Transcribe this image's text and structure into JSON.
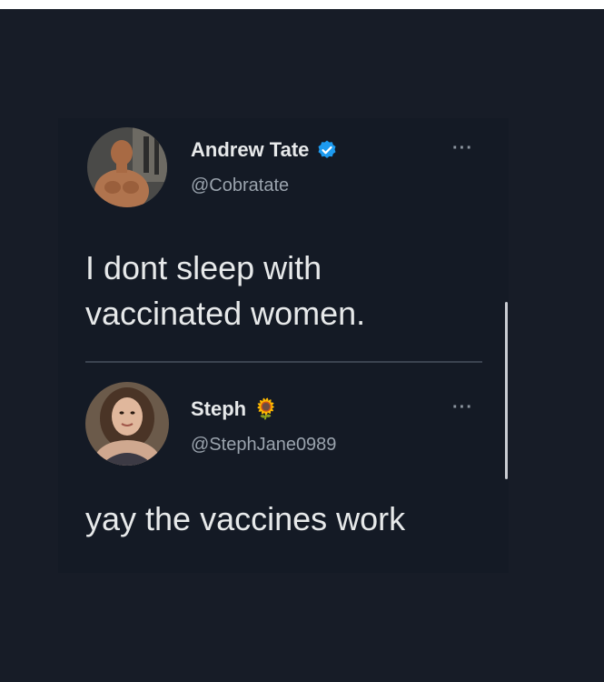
{
  "tweet": {
    "author_name": "Andrew Tate",
    "author_handle": "@Cobratate",
    "verified_icon": "verified-badge-icon",
    "more_label": "···",
    "text_line1": "I dont sleep with",
    "text_line2": "vaccinated women."
  },
  "reply": {
    "author_name": "Steph",
    "author_emoji": "🌻",
    "author_handle": "@StephJane0989",
    "more_label": "···",
    "text": "yay the vaccines work"
  },
  "colors": {
    "background": "#171c27",
    "card": "#141a25",
    "text": "#e7e9ea",
    "muted": "#9aa3ad",
    "verified": "#1d9bf0"
  }
}
